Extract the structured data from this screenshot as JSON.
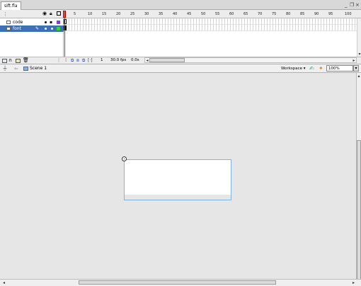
{
  "window": {
    "doc_tab": "sift.fla",
    "controls": [
      "_",
      "❐",
      "×"
    ]
  },
  "timeline": {
    "frame_numbers": [
      "5",
      "10",
      "15",
      "20",
      "25",
      "30",
      "35",
      "40",
      "45",
      "50",
      "55",
      "60",
      "65",
      "70",
      "75",
      "80",
      "85",
      "90",
      "95",
      "100"
    ],
    "layers": [
      {
        "name": "code",
        "selected": false
      },
      {
        "name": "font",
        "selected": true
      }
    ],
    "footer": {
      "current_frame": "1",
      "frame_rate": "30.0 fps",
      "elapsed": "0.0s"
    }
  },
  "editbar": {
    "scene": "Scene 1",
    "workspace": "Workspace ▾",
    "zoom": "100%"
  },
  "colors": {
    "selected_layer": "#3d6fb4",
    "playhead": "#d22222",
    "stage_border": "#7fb4e0"
  },
  "icons": [
    "eye-icon",
    "lock-icon",
    "outline-icon",
    "pencil-icon",
    "back-arrow-icon",
    "scene-icon",
    "edit-symbols-icon",
    "edit-scene-icon",
    "registration-point-icon"
  ]
}
